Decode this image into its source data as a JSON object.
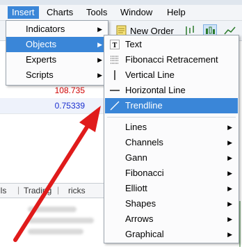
{
  "window": {
    "title": "Insert"
  },
  "menubar": {
    "items": [
      {
        "label": "Insert",
        "active": true
      },
      {
        "label": "Charts"
      },
      {
        "label": "Tools"
      },
      {
        "label": "Window"
      },
      {
        "label": "Help"
      }
    ]
  },
  "toolbar": {
    "new_order_label": "New Order"
  },
  "quotes": {
    "values": [
      "108.735",
      "0.75339"
    ],
    "colors": [
      "#d00000",
      "#1a2fd0"
    ]
  },
  "bottom_tabs": [
    "ils",
    "Trading",
    "ricks"
  ],
  "insert_menu": {
    "items": [
      {
        "label": "Indicators",
        "submenu": true
      },
      {
        "label": "Objects",
        "submenu": true,
        "active": true
      },
      {
        "label": "Experts",
        "submenu": true
      },
      {
        "label": "Scripts",
        "submenu": true
      }
    ]
  },
  "objects_menu": {
    "items": [
      {
        "label": "Text",
        "icon": "text-tool-icon"
      },
      {
        "label": "Fibonacci Retracement",
        "icon": "fibonacci-icon"
      },
      {
        "label": "Vertical Line",
        "icon": "vertical-line-icon"
      },
      {
        "label": "Horizontal Line",
        "icon": "horizontal-line-icon"
      },
      {
        "label": "Trendline",
        "icon": "trendline-icon",
        "active": true
      },
      {
        "label": "Lines",
        "submenu": true
      },
      {
        "label": "Channels",
        "submenu": true
      },
      {
        "label": "Gann",
        "submenu": true
      },
      {
        "label": "Fibonacci",
        "submenu": true
      },
      {
        "label": "Elliott",
        "submenu": true
      },
      {
        "label": "Shapes",
        "submenu": true
      },
      {
        "label": "Arrows",
        "submenu": true
      },
      {
        "label": "Graphical",
        "submenu": true
      }
    ]
  },
  "colors": {
    "accent": "#3a86d8",
    "annotation_arrow": "#e01b1b"
  }
}
